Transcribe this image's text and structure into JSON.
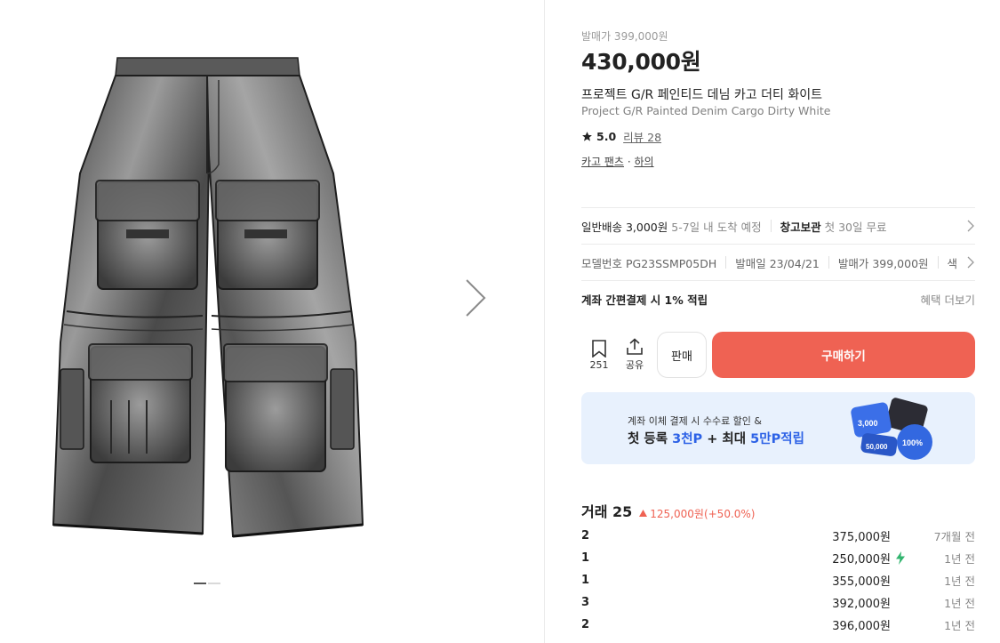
{
  "gallery": {
    "indicator_count": 2,
    "active_index": 0
  },
  "product": {
    "release_price": "발매가 399,000원",
    "price": "430,000원",
    "title_ko": "프로젝트 G/R 페인티드 데님 카고 더티 화이트",
    "title_en": "Project G/R Painted Denim Cargo Dirty White",
    "rating": "5.0",
    "review_label": "리뷰 28",
    "category_1": "카고 팬츠",
    "category_dot": "·",
    "category_2": "하의"
  },
  "shipping": {
    "label": "일반배송 3,000원",
    "eta": "5-7일 내 도착 예정",
    "storage_label": "창고보관",
    "storage_value": "첫 30일 무료"
  },
  "model": {
    "model_no": "모델번호 PG23SSMP05DH",
    "release_date": "발매일 23/04/21",
    "release_price": "발매가 399,000원",
    "more": "색"
  },
  "points": {
    "label": "계좌 간편결제 시 1% 적립",
    "more_label": "혜택 더보기"
  },
  "actions": {
    "wish_count": "251",
    "share_label": "공유",
    "sell_label": "판매",
    "buy_label": "구매하기"
  },
  "banner": {
    "sub": "계좌 이체 결제 시 수수료 할인 &",
    "main_1": "첫 등록 ",
    "main_hl1": "3천P",
    "main_2": " + 최대 ",
    "main_hl2": "5만P적립",
    "coin_1": "3,000",
    "coin_2": "50,000",
    "coin_3": "100%"
  },
  "trades": {
    "title": "거래 25",
    "delta": "125,000원(+50.0%)",
    "rows": [
      {
        "size": "2",
        "price": "375,000원",
        "fast": false,
        "date": "7개월 전"
      },
      {
        "size": "1",
        "price": "250,000원",
        "fast": true,
        "date": "1년 전"
      },
      {
        "size": "1",
        "price": "355,000원",
        "fast": false,
        "date": "1년 전"
      },
      {
        "size": "3",
        "price": "392,000원",
        "fast": false,
        "date": "1년 전"
      },
      {
        "size": "2",
        "price": "396,000원",
        "fast": false,
        "date": "1년 전"
      }
    ]
  },
  "colors": {
    "accent_red": "#ef6253",
    "accent_blue": "#2d62e6",
    "banner_bg": "#e8f1fd",
    "fast_green": "#31b46e"
  },
  "icons": {
    "next": "chevron-right-icon",
    "wish": "bookmark-icon",
    "share": "share-icon",
    "rating": "star-icon",
    "up": "triangle-up-icon",
    "fast": "lightning-icon"
  }
}
